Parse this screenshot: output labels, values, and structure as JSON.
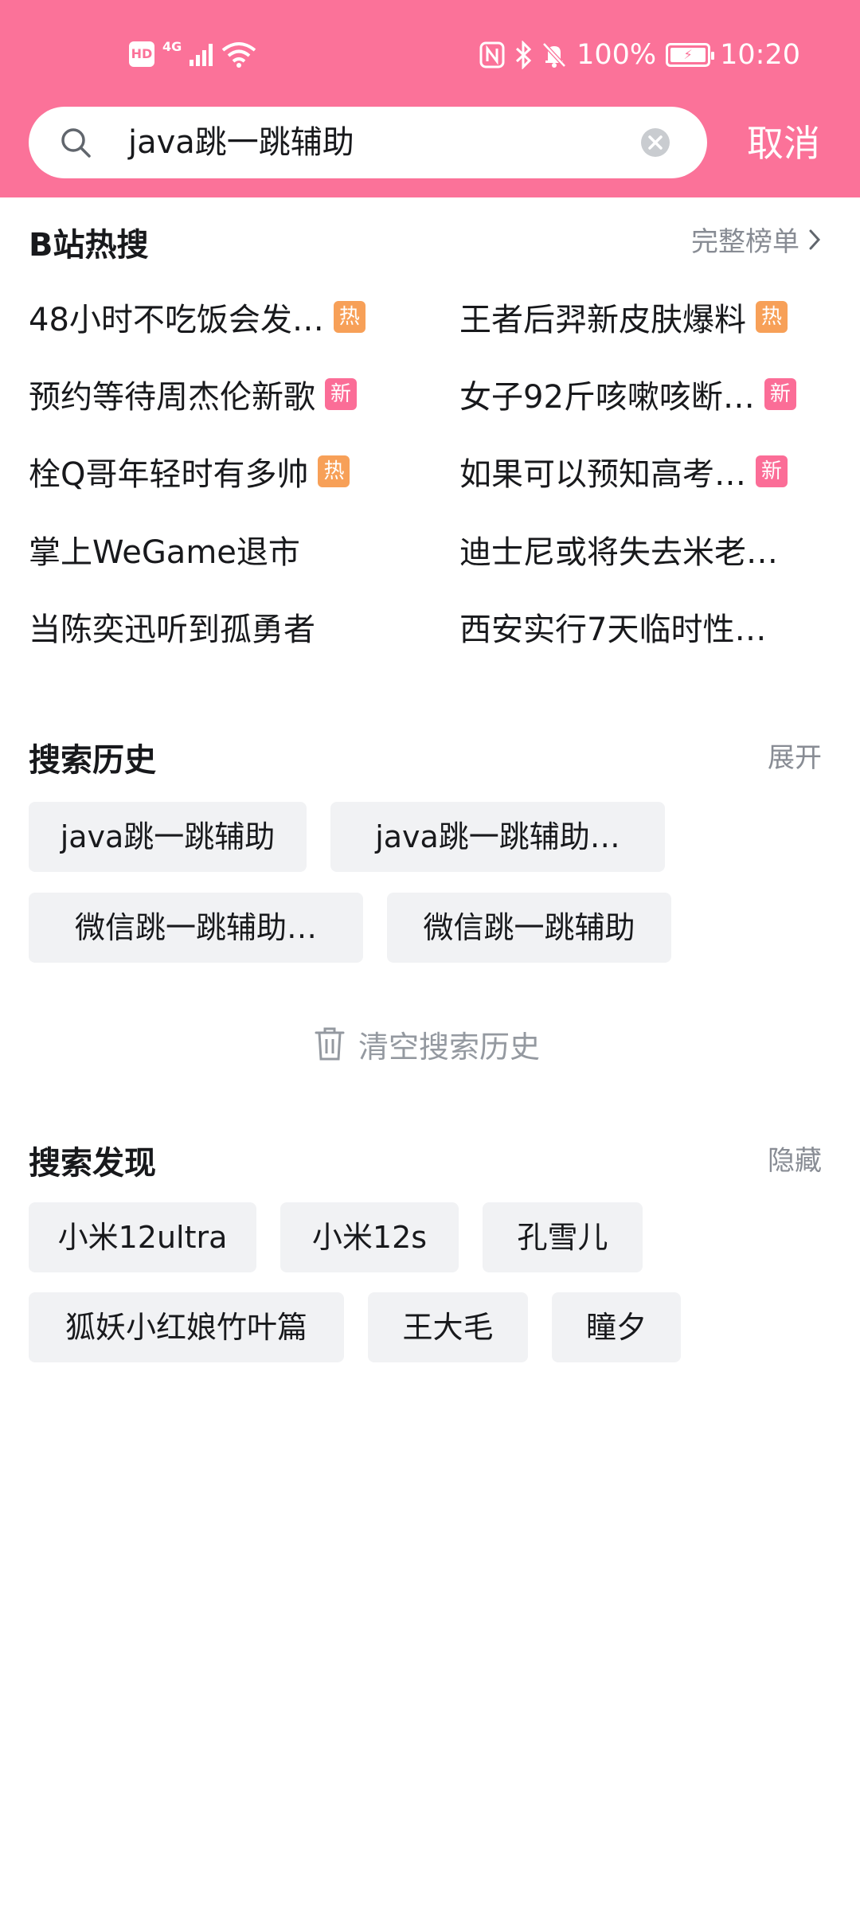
{
  "status_bar": {
    "network_badge": "HD",
    "network_type": "4G",
    "battery": "100%",
    "time": "10:20",
    "icons": [
      "nfc-icon",
      "bluetooth-icon",
      "mute-icon",
      "battery-icon",
      "wifi-icon",
      "signal-icon"
    ]
  },
  "search": {
    "query": "java跳一跳辅助",
    "cancel_label": "取消"
  },
  "hot": {
    "title": "B站热搜",
    "full_list_label": "完整榜单",
    "items": [
      {
        "text": "48小时不吃饭会发…",
        "tag": "热"
      },
      {
        "text": "王者后羿新皮肤爆料",
        "tag": "热"
      },
      {
        "text": "预约等待周杰伦新歌",
        "tag": "新"
      },
      {
        "text": "女子92斤咳嗽咳断…",
        "tag": "新"
      },
      {
        "text": "栓Q哥年轻时有多帅",
        "tag": "热"
      },
      {
        "text": "如果可以预知高考…",
        "tag": "新"
      },
      {
        "text": "掌上WeGame退市",
        "tag": ""
      },
      {
        "text": "迪士尼或将失去米老…",
        "tag": ""
      },
      {
        "text": "当陈奕迅听到孤勇者",
        "tag": ""
      },
      {
        "text": "西安实行7天临时性管…",
        "tag": ""
      }
    ]
  },
  "history": {
    "title": "搜索历史",
    "expand_label": "展开",
    "items": [
      "java跳一跳辅助",
      "java跳一跳辅助…",
      "微信跳一跳辅助…",
      "微信跳一跳辅助"
    ],
    "clear_label": "清空搜索历史"
  },
  "discover": {
    "title": "搜索发现",
    "hide_label": "隐藏",
    "items": [
      "小米12ultra",
      "小米12s",
      "孔雪儿",
      "狐妖小红娘竹叶篇",
      "王大毛",
      "瞳夕"
    ]
  },
  "colors": {
    "brand_pink": "#fb7299",
    "hot_tag": "#f7a058",
    "new_tag": "#fb6d97",
    "chip_bg": "#f1f2f4"
  }
}
